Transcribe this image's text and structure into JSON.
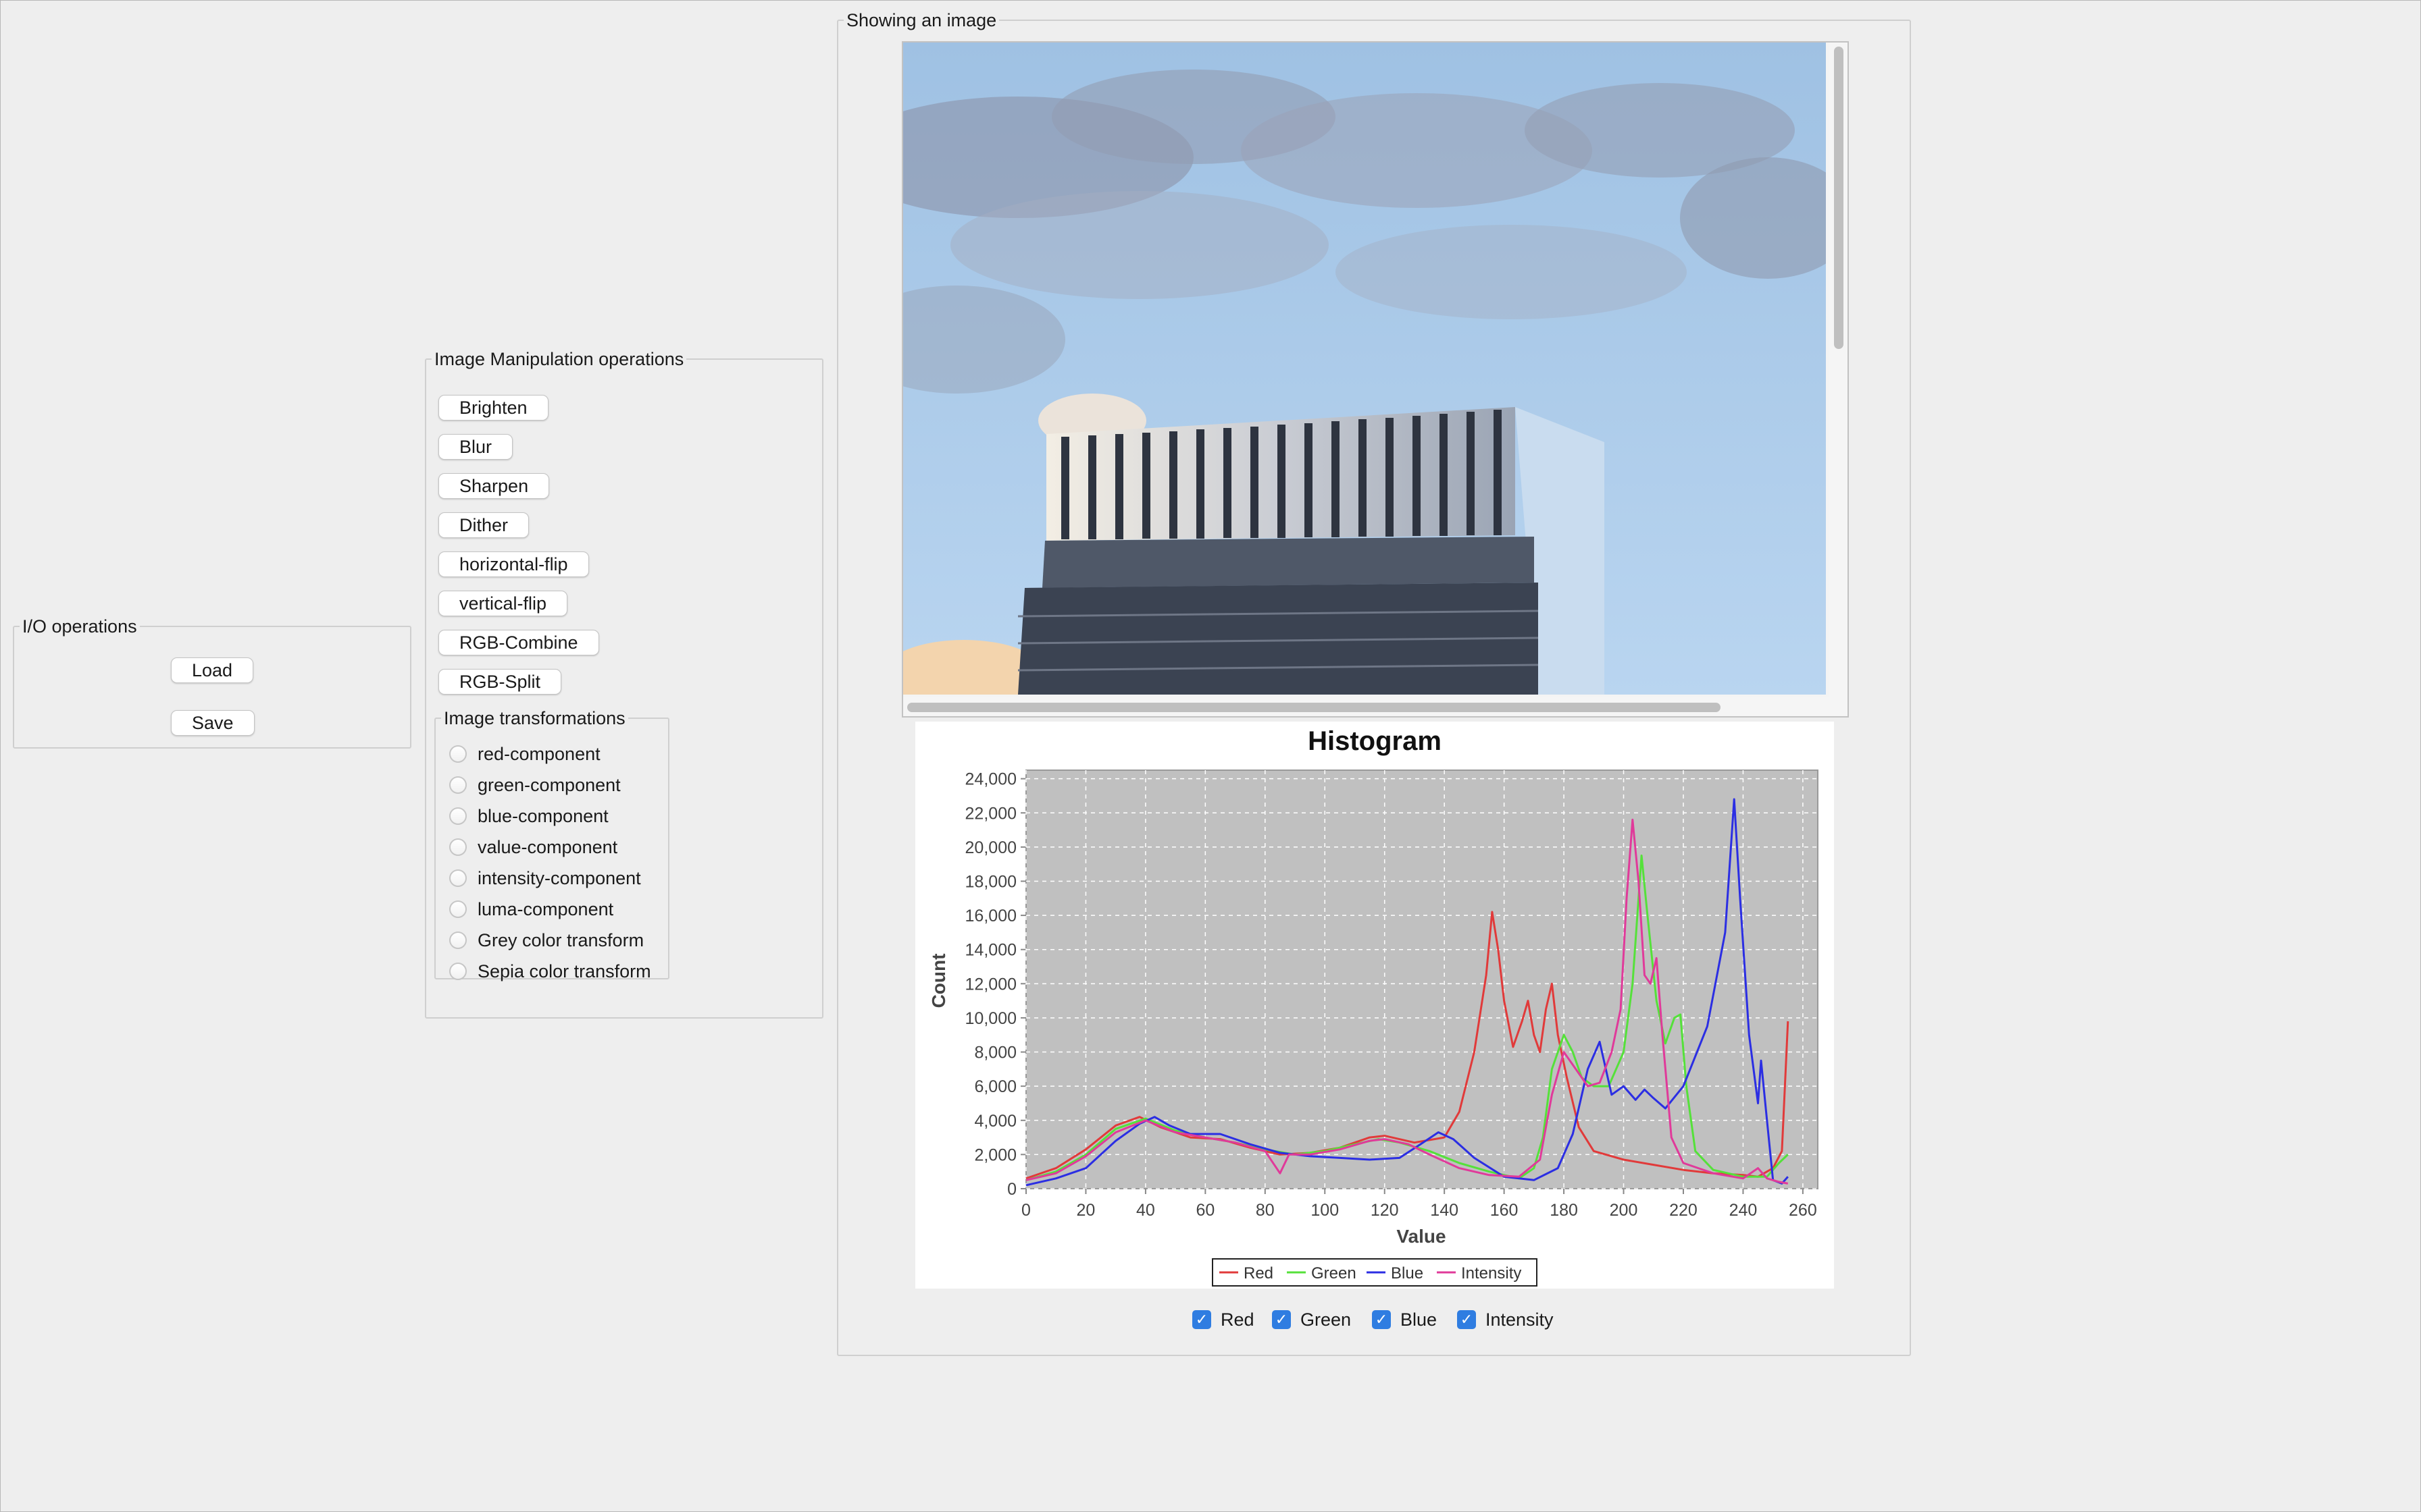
{
  "io_panel": {
    "title": "I/O operations",
    "load_label": "Load",
    "save_label": "Save"
  },
  "manip_panel": {
    "title": "Image Manipulation operations",
    "buttons": [
      "Brighten",
      "Blur",
      "Sharpen",
      "Dither",
      "horizontal-flip",
      "vertical-flip",
      "RGB-Combine",
      "RGB-Split"
    ]
  },
  "transform_panel": {
    "title": "Image transformations",
    "options": [
      "red-component",
      "green-component",
      "blue-component",
      "value-component",
      "intensity-component",
      "luma-component",
      "Grey color transform",
      "Sepia color transform"
    ]
  },
  "image_panel": {
    "title": "Showing an image"
  },
  "colors": {
    "window_bg": "#eeeeee",
    "sky": "#a9c8e6",
    "plot_bg": "#c0c0c0",
    "red": "#e13a3a",
    "green": "#55e13a",
    "blue": "#2b2ee3",
    "intensity": "#e03a9a",
    "checkbox": "#2f7de1"
  },
  "chart_data": {
    "type": "line",
    "title": "Histogram",
    "xlabel": "Value",
    "ylabel": "Count",
    "xlim": [
      0,
      265
    ],
    "ylim": [
      0,
      24500
    ],
    "xticks": [
      0,
      20,
      40,
      60,
      80,
      100,
      120,
      140,
      160,
      180,
      200,
      220,
      240,
      260
    ],
    "yticks": [
      0,
      2000,
      4000,
      6000,
      8000,
      10000,
      12000,
      14000,
      16000,
      18000,
      20000,
      22000,
      24000
    ],
    "ytick_labels": [
      "0",
      "2,000",
      "4,000",
      "6,000",
      "8,000",
      "10,000",
      "12,000",
      "14,000",
      "16,000",
      "18,000",
      "20,000",
      "22,000",
      "24,000"
    ],
    "grid": true,
    "legend_position": "bottom",
    "series": [
      {
        "name": "Red",
        "points": [
          [
            0,
            600
          ],
          [
            10,
            1200
          ],
          [
            20,
            2300
          ],
          [
            30,
            3700
          ],
          [
            38,
            4200
          ],
          [
            45,
            3600
          ],
          [
            55,
            3000
          ],
          [
            65,
            2900
          ],
          [
            75,
            2400
          ],
          [
            85,
            2000
          ],
          [
            95,
            2100
          ],
          [
            105,
            2400
          ],
          [
            115,
            3000
          ],
          [
            120,
            3100
          ],
          [
            130,
            2700
          ],
          [
            140,
            3000
          ],
          [
            145,
            4500
          ],
          [
            150,
            8000
          ],
          [
            154,
            12500
          ],
          [
            156,
            16200
          ],
          [
            158,
            14000
          ],
          [
            160,
            11000
          ],
          [
            163,
            8300
          ],
          [
            166,
            9800
          ],
          [
            168,
            11000
          ],
          [
            170,
            9000
          ],
          [
            172,
            8000
          ],
          [
            174,
            10500
          ],
          [
            176,
            12000
          ],
          [
            178,
            9000
          ],
          [
            181,
            6500
          ],
          [
            185,
            3600
          ],
          [
            190,
            2200
          ],
          [
            200,
            1700
          ],
          [
            210,
            1400
          ],
          [
            220,
            1100
          ],
          [
            230,
            900
          ],
          [
            240,
            800
          ],
          [
            245,
            700
          ],
          [
            250,
            1200
          ],
          [
            253,
            2200
          ],
          [
            255,
            9800
          ]
        ]
      },
      {
        "name": "Green",
        "points": [
          [
            0,
            500
          ],
          [
            10,
            1000
          ],
          [
            20,
            2000
          ],
          [
            30,
            3500
          ],
          [
            40,
            4100
          ],
          [
            50,
            3400
          ],
          [
            60,
            3000
          ],
          [
            70,
            2700
          ],
          [
            80,
            2300
          ],
          [
            90,
            2000
          ],
          [
            100,
            2200
          ],
          [
            110,
            2600
          ],
          [
            118,
            2900
          ],
          [
            125,
            2700
          ],
          [
            135,
            2200
          ],
          [
            145,
            1500
          ],
          [
            155,
            1000
          ],
          [
            165,
            600
          ],
          [
            170,
            1200
          ],
          [
            173,
            3000
          ],
          [
            176,
            7000
          ],
          [
            180,
            9000
          ],
          [
            183,
            8000
          ],
          [
            186,
            6500
          ],
          [
            190,
            6000
          ],
          [
            195,
            6000
          ],
          [
            200,
            8000
          ],
          [
            203,
            12000
          ],
          [
            206,
            19500
          ],
          [
            208,
            16000
          ],
          [
            211,
            11000
          ],
          [
            214,
            8500
          ],
          [
            217,
            10000
          ],
          [
            219,
            10200
          ],
          [
            221,
            6000
          ],
          [
            224,
            2200
          ],
          [
            230,
            1100
          ],
          [
            240,
            700
          ],
          [
            248,
            700
          ],
          [
            252,
            1500
          ],
          [
            255,
            2000
          ]
        ]
      },
      {
        "name": "Blue",
        "points": [
          [
            0,
            200
          ],
          [
            10,
            600
          ],
          [
            20,
            1200
          ],
          [
            30,
            2800
          ],
          [
            38,
            3800
          ],
          [
            43,
            4200
          ],
          [
            48,
            3700
          ],
          [
            55,
            3200
          ],
          [
            65,
            3200
          ],
          [
            75,
            2600
          ],
          [
            85,
            2100
          ],
          [
            95,
            1900
          ],
          [
            105,
            1800
          ],
          [
            115,
            1700
          ],
          [
            125,
            1800
          ],
          [
            132,
            2600
          ],
          [
            138,
            3300
          ],
          [
            143,
            2900
          ],
          [
            150,
            1800
          ],
          [
            160,
            700
          ],
          [
            170,
            500
          ],
          [
            178,
            1200
          ],
          [
            183,
            3200
          ],
          [
            188,
            7000
          ],
          [
            192,
            8600
          ],
          [
            196,
            5500
          ],
          [
            200,
            6000
          ],
          [
            204,
            5200
          ],
          [
            207,
            5800
          ],
          [
            210,
            5300
          ],
          [
            214,
            4700
          ],
          [
            220,
            6000
          ],
          [
            228,
            9500
          ],
          [
            234,
            15000
          ],
          [
            237,
            22800
          ],
          [
            239,
            17000
          ],
          [
            242,
            9000
          ],
          [
            245,
            5000
          ],
          [
            246,
            7500
          ],
          [
            248,
            4000
          ],
          [
            250,
            500
          ],
          [
            253,
            300
          ],
          [
            255,
            700
          ]
        ]
      },
      {
        "name": "Intensity",
        "points": [
          [
            0,
            500
          ],
          [
            10,
            900
          ],
          [
            20,
            1900
          ],
          [
            30,
            3300
          ],
          [
            40,
            4000
          ],
          [
            50,
            3300
          ],
          [
            60,
            3000
          ],
          [
            70,
            2700
          ],
          [
            80,
            2200
          ],
          [
            85,
            900
          ],
          [
            88,
            2000
          ],
          [
            95,
            2000
          ],
          [
            105,
            2300
          ],
          [
            115,
            2800
          ],
          [
            120,
            2900
          ],
          [
            128,
            2600
          ],
          [
            135,
            2000
          ],
          [
            145,
            1200
          ],
          [
            155,
            800
          ],
          [
            165,
            700
          ],
          [
            172,
            1700
          ],
          [
            176,
            5500
          ],
          [
            180,
            8000
          ],
          [
            184,
            7000
          ],
          [
            188,
            6000
          ],
          [
            192,
            6200
          ],
          [
            196,
            8000
          ],
          [
            199,
            10500
          ],
          [
            201,
            17000
          ],
          [
            203,
            21600
          ],
          [
            205,
            18000
          ],
          [
            207,
            12500
          ],
          [
            209,
            12000
          ],
          [
            211,
            13500
          ],
          [
            213,
            9000
          ],
          [
            216,
            3000
          ],
          [
            220,
            1500
          ],
          [
            230,
            900
          ],
          [
            240,
            600
          ],
          [
            245,
            1200
          ],
          [
            248,
            600
          ],
          [
            252,
            400
          ],
          [
            255,
            300
          ]
        ]
      }
    ]
  },
  "series_toggles": {
    "red": "Red",
    "green": "Green",
    "blue": "Blue",
    "intensity": "Intensity"
  }
}
